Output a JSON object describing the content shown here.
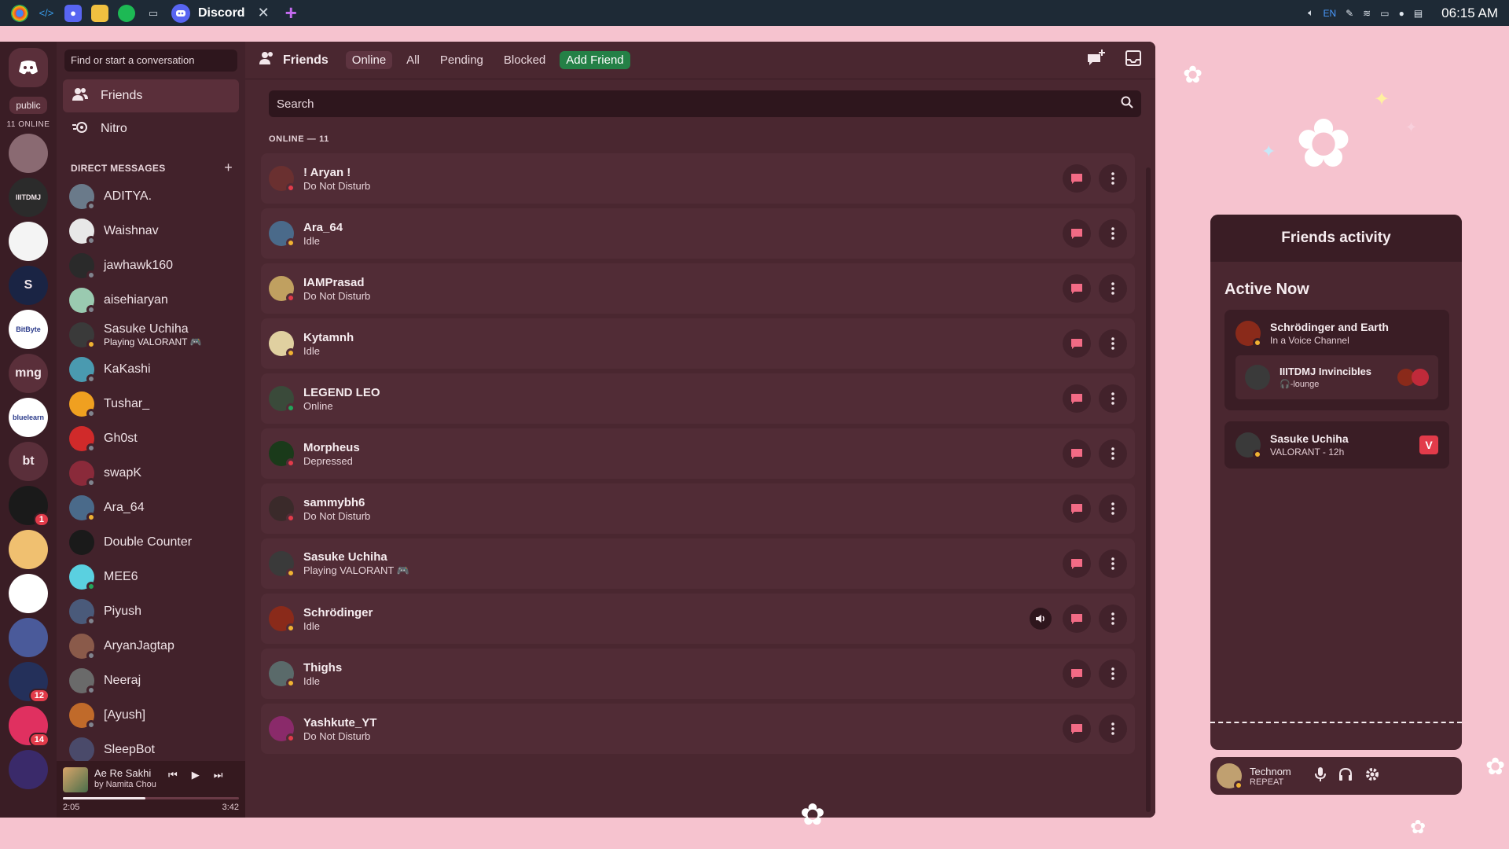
{
  "taskbar": {
    "app_title": "Discord",
    "close_glyph": "✕",
    "new_tab_glyph": "+",
    "lang": "EN",
    "clock": "06:15 AM"
  },
  "rail": {
    "public_label": "public",
    "online_label": "11 ONLINE",
    "servers": [
      {
        "name": "server-anime",
        "text": "",
        "color": "#8a6a72",
        "badge": ""
      },
      {
        "name": "server-iiitdmj",
        "text": "IIITDMJ",
        "color": "#2b2b2b",
        "badge": ""
      },
      {
        "name": "server-red",
        "text": "",
        "color": "#f4f4f4",
        "badge": ""
      },
      {
        "name": "server-blue",
        "text": "S",
        "color": "#1a2444",
        "badge": ""
      },
      {
        "name": "server-bitbyte",
        "text": "BitByte",
        "color": "#ffffff",
        "badge": ""
      },
      {
        "name": "server-mng",
        "text": "mng",
        "color": "#5a2f3a",
        "badge": ""
      },
      {
        "name": "server-bluelearn",
        "text": "bluelearn",
        "color": "#ffffff",
        "badge": ""
      },
      {
        "name": "server-bt",
        "text": "bt",
        "color": "#5a2f3a",
        "badge": ""
      },
      {
        "name": "server-dark",
        "text": "",
        "color": "#1a1a1a",
        "badge": "1"
      },
      {
        "name": "server-pixel",
        "text": "",
        "color": "#f0c070",
        "badge": ""
      },
      {
        "name": "server-fire",
        "text": "",
        "color": "#ffffff",
        "badge": ""
      },
      {
        "name": "server-face",
        "text": "",
        "color": "#4a5a9a",
        "badge": ""
      },
      {
        "name": "server-mix",
        "text": "",
        "color": "#24305a",
        "badge": "12"
      },
      {
        "name": "server-pink",
        "text": "",
        "color": "#e03060",
        "badge": "14"
      },
      {
        "name": "server-purple",
        "text": "",
        "color": "#3a2a6a",
        "badge": ""
      }
    ]
  },
  "dm": {
    "search_placeholder": "Find or start a conversation",
    "nav": [
      {
        "label": "Friends",
        "icon": "friends-icon"
      },
      {
        "label": "Nitro",
        "icon": "nitro-icon"
      }
    ],
    "header": "DIRECT MESSAGES",
    "add_glyph": "+",
    "items": [
      {
        "name": "ADITYA.",
        "sub": "",
        "status": "st-off",
        "color": "#6a7a8a"
      },
      {
        "name": "Waishnav",
        "sub": "",
        "status": "st-off",
        "color": "#e8e8e8"
      },
      {
        "name": "jawhawk160",
        "sub": "",
        "status": "st-off",
        "color": "#2a2a2a"
      },
      {
        "name": "aisehiaryan",
        "sub": "",
        "status": "st-off",
        "color": "#9acab0"
      },
      {
        "name": "Sasuke Uchiha",
        "sub": "Playing VALORANT 🎮",
        "status": "st-idle",
        "color": "#3a3a3a"
      },
      {
        "name": "KaKashi",
        "sub": "",
        "status": "st-off",
        "color": "#4a9ab0"
      },
      {
        "name": "Tushar_",
        "sub": "",
        "status": "st-off",
        "color": "#f0a020"
      },
      {
        "name": "Gh0st",
        "sub": "",
        "status": "st-off",
        "color": "#d02a2a"
      },
      {
        "name": "swapK",
        "sub": "",
        "status": "st-off",
        "color": "#8a2a3a"
      },
      {
        "name": "Ara_64",
        "sub": "",
        "status": "st-idle",
        "color": "#4a6a8a"
      },
      {
        "name": "Double Counter",
        "sub": "",
        "status": "",
        "color": "#1a1a1a"
      },
      {
        "name": "MEE6",
        "sub": "",
        "status": "st-online",
        "color": "#5ad0e0"
      },
      {
        "name": "Piyush",
        "sub": "",
        "status": "st-off",
        "color": "#4a5a7a"
      },
      {
        "name": "AryanJagtap",
        "sub": "",
        "status": "st-off",
        "color": "#8a5a4a"
      },
      {
        "name": "Neeraj",
        "sub": "",
        "status": "st-off",
        "color": "#6a6a6a"
      },
      {
        "name": "[Ayush]",
        "sub": "",
        "status": "st-off",
        "color": "#c06a2a"
      },
      {
        "name": "SleepBot",
        "sub": "",
        "status": "",
        "color": "#4a4a6a"
      }
    ]
  },
  "player": {
    "title": "Ae Re Sakhi",
    "artist": "by Namita Chou",
    "elapsed": "2:05",
    "duration": "3:42",
    "progress": 0.47
  },
  "topbar": {
    "title": "Friends",
    "tabs": [
      "Online",
      "All",
      "Pending",
      "Blocked"
    ],
    "add_friend": "Add Friend"
  },
  "search": {
    "placeholder": "Search"
  },
  "section_label": "ONLINE — 11",
  "friends": [
    {
      "name": "! Aryan !",
      "sub": "Do Not Disturb",
      "status": "st-dnd",
      "color": "#6a3030",
      "voice": false
    },
    {
      "name": "Ara_64",
      "sub": "Idle",
      "status": "st-idle",
      "color": "#4a6a8a",
      "voice": false
    },
    {
      "name": "IAMPrasad",
      "sub": "Do Not Disturb",
      "status": "st-dnd",
      "color": "#c0a060",
      "voice": false
    },
    {
      "name": "Kytamnh",
      "sub": "Idle",
      "status": "st-idle",
      "color": "#e0d0a0",
      "voice": false
    },
    {
      "name": "LEGEND LEO",
      "sub": "Online",
      "status": "st-online",
      "color": "#3a4a3a",
      "voice": false
    },
    {
      "name": "Morpheus",
      "sub": "Depressed",
      "status": "st-dnd",
      "color": "#1a3a1a",
      "voice": false
    },
    {
      "name": "sammybh6",
      "sub": "Do Not Disturb",
      "status": "st-dnd",
      "color": "#3a2a2a",
      "voice": false
    },
    {
      "name": "Sasuke Uchiha",
      "sub": "Playing VALORANT 🎮",
      "status": "st-idle",
      "color": "#3a3a3a",
      "voice": false
    },
    {
      "name": "Schrödinger",
      "sub": "Idle",
      "status": "st-idle",
      "color": "#8a2a1a",
      "voice": true
    },
    {
      "name": "Thighs",
      "sub": "Idle",
      "status": "st-idle",
      "color": "#5a6a6a",
      "voice": false
    },
    {
      "name": "Yashkute_YT",
      "sub": "Do Not Disturb",
      "status": "st-dnd",
      "color": "#8a2a6a",
      "voice": false
    }
  ],
  "activity": {
    "title": "Friends activity",
    "active_now": "Active Now",
    "cards": [
      {
        "name": "Schrödinger and Earth",
        "sub": "In a Voice Channel",
        "vc_name": "IIITDMJ Invincibles",
        "vc_sub": "🎧-lounge"
      },
      {
        "name": "Sasuke Uchiha",
        "sub": "VALORANT - 12h"
      }
    ]
  },
  "user": {
    "name": "Technom",
    "sub": "REPEAT"
  },
  "colors": {
    "accent_green": "#248046",
    "dnd": "#e23b4a",
    "idle": "#f0b232",
    "online": "#23a55a"
  }
}
